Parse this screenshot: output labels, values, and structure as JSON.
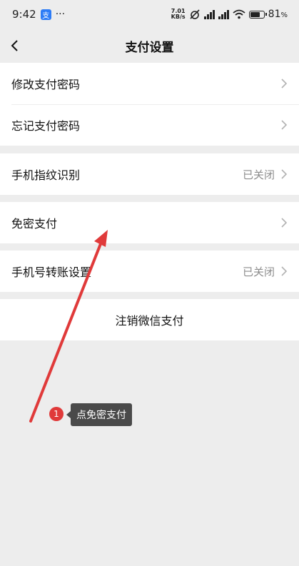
{
  "status_bar": {
    "time": "9:42",
    "app_badge": "支",
    "more": "···",
    "speed_value": "7.01",
    "speed_unit": "KB/s",
    "battery_percent": "81",
    "battery_unit": "%",
    "battery_level": 0.81
  },
  "nav": {
    "title": "支付设置"
  },
  "groups": {
    "password": {
      "change_label": "修改支付密码",
      "forgot_label": "忘记支付密码"
    },
    "fingerprint": {
      "label": "手机指纹识别",
      "value": "已关闭"
    },
    "no_password": {
      "label": "免密支付"
    },
    "phone_transfer": {
      "label": "手机号转账设置",
      "value": "已关闭"
    },
    "logout": {
      "label": "注销微信支付"
    }
  },
  "annotation": {
    "step": "1",
    "text": "点免密支付",
    "color": "#e03a3a"
  }
}
